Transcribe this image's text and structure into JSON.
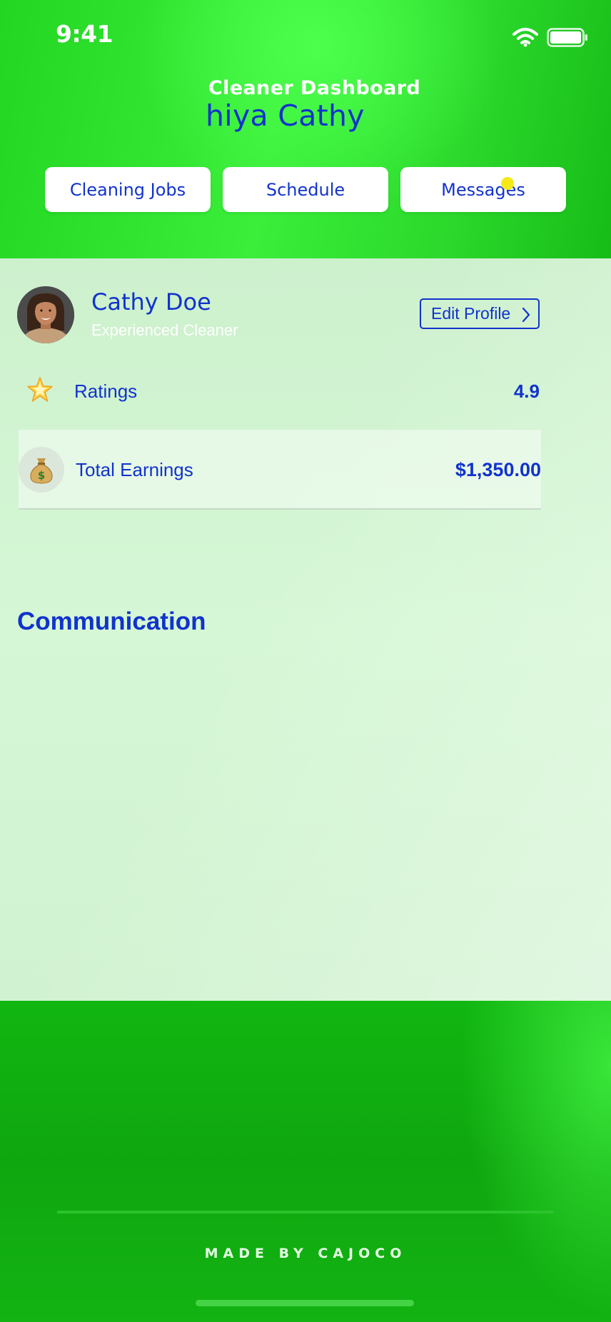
{
  "status_bar": {
    "time": "9:41"
  },
  "header": {
    "title": "Cleaner Dashboard",
    "greeting": "hiya Cathy",
    "tabs": [
      {
        "label": "Cleaning Jobs"
      },
      {
        "label": "Schedule"
      },
      {
        "label": "Messages",
        "has_notification": true
      }
    ]
  },
  "profile": {
    "name": "Cathy Doe",
    "role": "Experienced Cleaner",
    "edit_label": "Edit Profile"
  },
  "stats": {
    "ratings": {
      "label": "Ratings",
      "value": "4.9",
      "icon": "star-icon"
    },
    "earnings": {
      "label": "Total Earnings",
      "value": "$1,350.00",
      "icon": "money-bag-icon"
    }
  },
  "communication": {
    "title": "Communication"
  },
  "footer": {
    "credit": "MADE BY CAJOCO"
  },
  "colors": {
    "accent_blue": "#1133cc",
    "header_green": "#3aee3a",
    "footer_green": "#0fa70f",
    "content_bg": "#d2f4d2",
    "notification_dot": "#f4ea18"
  }
}
